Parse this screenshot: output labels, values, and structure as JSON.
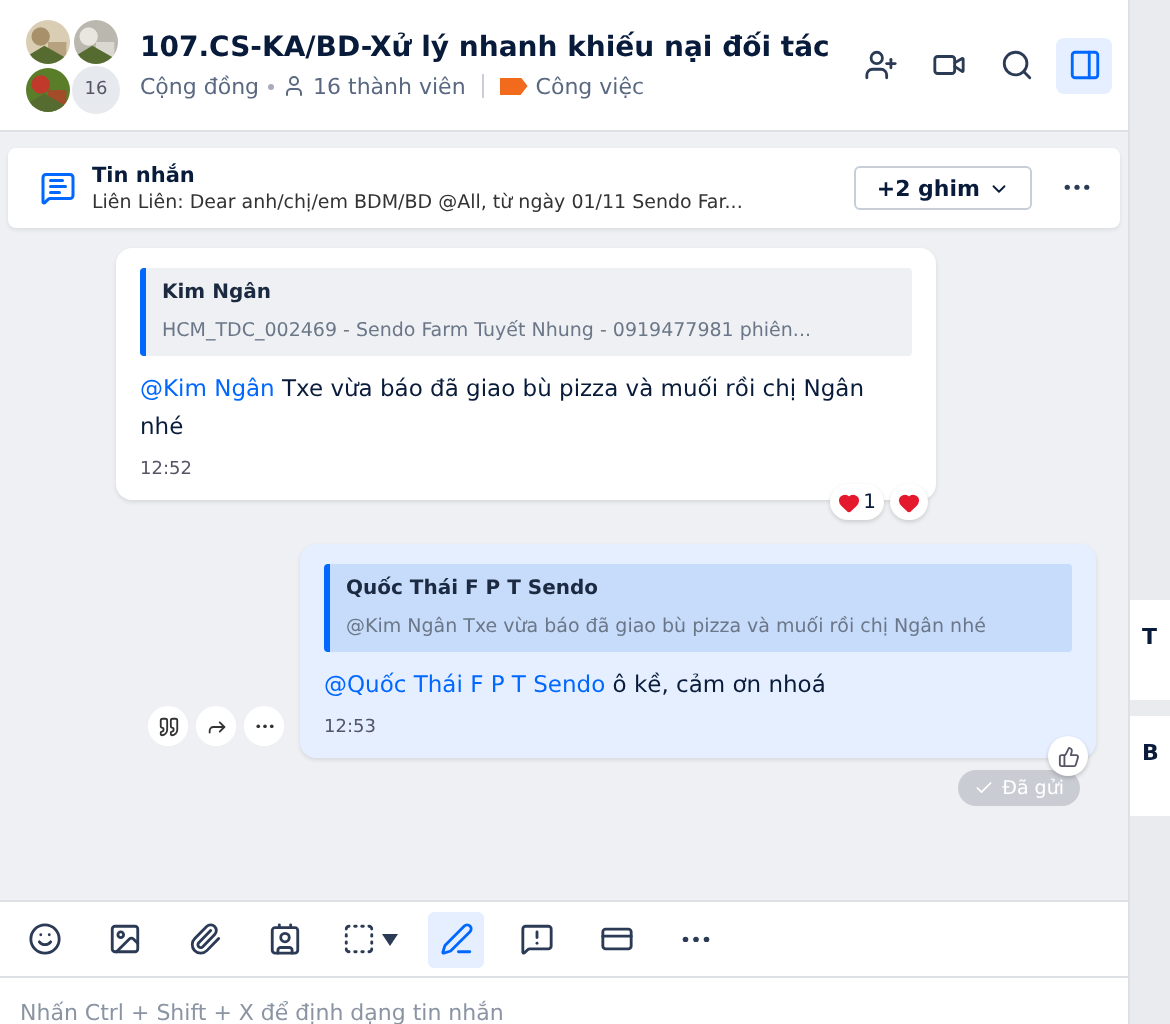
{
  "header": {
    "title": "107.CS-KA/BD-Xử lý nhanh khiếu nại đối tác",
    "avatar_count": "16",
    "type": "Cộng đồng",
    "members": "16 thành viên",
    "label": {
      "text": "Công việc",
      "color": "#f26b1d"
    }
  },
  "pinned": {
    "title": "Tin nhắn",
    "preview": "Liên Liên: Dear anh/chị/em BDM/BD @All, từ ngày 01/11 Sendo Far...",
    "pins_button": "+2 ghim"
  },
  "messages": [
    {
      "mine": false,
      "quote": {
        "author": "Kim Ngân",
        "text": "HCM_TDC_002469 - Sendo Farm Tuyết Nhung - 0919477981 phiên..."
      },
      "mention": "@Kim Ngân",
      "text": "Txe vừa báo đã giao bù pizza và muối rồi chị Ngân nhé",
      "time": "12:52",
      "reactions": [
        {
          "count": "1"
        }
      ]
    },
    {
      "mine": true,
      "quote": {
        "author": "Quốc Thái F P T Sendo",
        "text": "@Kim Ngân Txe vừa báo đã giao bù pizza và muối rồi chị Ngân nhé"
      },
      "mention": "@Quốc Thái F P T Sendo",
      "text": "ô kề, cảm ơn nhoá",
      "time": "12:53",
      "status": "Đã gửi"
    }
  ],
  "side_panel": [
    "T",
    "B"
  ],
  "composer": {
    "placeholder": "Nhấn Ctrl + Shift + X để định dạng tin nhắn",
    "format_active": true
  }
}
